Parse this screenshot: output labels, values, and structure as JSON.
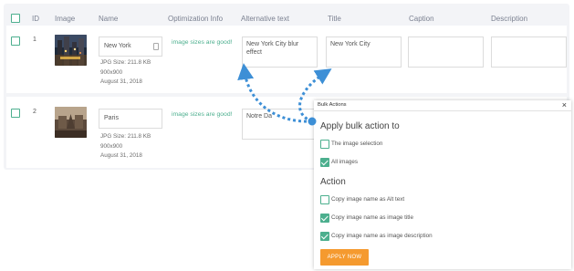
{
  "header": {
    "id": "ID",
    "image": "Image",
    "name": "Name",
    "optimization": "Optimization Info",
    "alt": "Alternative text",
    "title": "Title",
    "caption": "Caption",
    "description": "Description"
  },
  "rows": [
    {
      "id": "1",
      "name": "New York",
      "size": "JPG Size: 211.8 KB",
      "dimensions": "900x900",
      "date": "August 31, 2018",
      "optimization": "image sizes are good!",
      "alt": "New York City blur effect",
      "title": "New York City",
      "caption": "",
      "description": ""
    },
    {
      "id": "2",
      "name": "Paris",
      "size": "JPG Size: 211.8 KB",
      "dimensions": "900x900",
      "date": "August 31, 2018",
      "optimization": "image sizes are good!",
      "alt": "Notre Da"
    }
  ],
  "modal": {
    "title": "Bulk Actions",
    "close": "×",
    "heading_apply": "Apply bulk action to",
    "apply_options": [
      {
        "label": "The image selection",
        "checked": false
      },
      {
        "label": "All images",
        "checked": true
      }
    ],
    "heading_action": "Action",
    "actions": [
      {
        "label": "Copy image name as Alt text",
        "checked": false
      },
      {
        "label": "Copy image name as image title",
        "checked": true
      },
      {
        "label": "Copy image name as image description",
        "checked": true
      }
    ],
    "apply_button": "APPLY NOW"
  },
  "colors": {
    "accent_green": "#4caf8e",
    "apply_orange": "#f59a2f",
    "arrow_blue": "#3d8fd6",
    "panel_bg": "#f3f4f7"
  }
}
